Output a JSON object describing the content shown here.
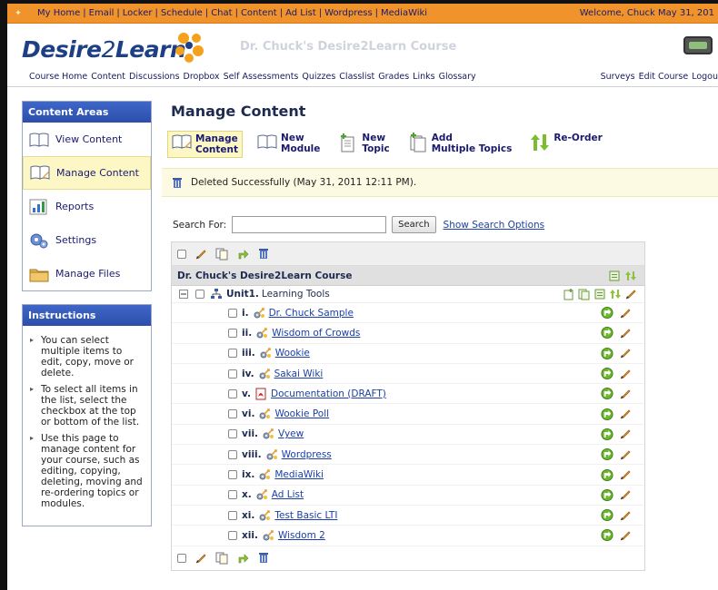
{
  "topbar": {
    "links": [
      "My Home",
      "Email",
      "Locker",
      "Schedule",
      "Chat",
      "Content",
      "Ad List",
      "Wordpress",
      "MediaWiki"
    ],
    "separator": "|",
    "welcome": "Welcome, Chuck  May 31, 201"
  },
  "header": {
    "logo_main": "Desire",
    "logo_two": "2",
    "logo_learn": "Learn",
    "course_title": "Dr. Chuck's Desire2Learn Course",
    "course_nav": [
      "Course Home",
      "Content",
      "Discussions",
      "Dropbox",
      "Self Assessments",
      "Quizzes",
      "Classlist",
      "Grades",
      "Links",
      "Glossary"
    ],
    "right_nav": [
      "Surveys",
      "Edit Course",
      "Logou"
    ]
  },
  "sidebar": {
    "content_areas_title": "Content Areas",
    "items": [
      {
        "label": "View Content",
        "icon": "book-icon"
      },
      {
        "label": "Manage Content",
        "icon": "manage-book-icon"
      },
      {
        "label": "Reports",
        "icon": "chart-icon"
      },
      {
        "label": "Settings",
        "icon": "gears-icon"
      },
      {
        "label": "Manage Files",
        "icon": "folder-icon"
      }
    ],
    "active_index": 1,
    "instructions_title": "Instructions",
    "instructions": [
      "You can select multiple items to edit, copy, move or delete.",
      "To select all items in the list, select the checkbox at the top or bottom of the list.",
      "Use this page to manage content for your course, such as editing, copying, deleting, moving and re-ordering topics or modules."
    ]
  },
  "main": {
    "title": "Manage Content",
    "toolbar": [
      {
        "line1": "Manage",
        "line2": "Content",
        "icon": "manage-content-icon"
      },
      {
        "line1": "New",
        "line2": "Module",
        "icon": "new-module-icon"
      },
      {
        "line1": "New",
        "line2": "Topic",
        "icon": "new-topic-icon"
      },
      {
        "line1": "Add",
        "line2": "Multiple Topics",
        "icon": "add-multiple-icon"
      },
      {
        "line1": "Re-Order",
        "line2": "",
        "icon": "reorder-icon"
      }
    ],
    "notice": "Deleted Successfully (May 31, 2011 12:11 PM).",
    "search_label": "Search For:",
    "search_value": "",
    "search_button": "Search",
    "search_options": "Show Search Options",
    "course_row": "Dr. Chuck's Desire2Learn Course",
    "module": {
      "label": "Unit1.",
      "title": "Learning Tools"
    },
    "topics": [
      {
        "num": "i.",
        "title": "Dr. Chuck Sample",
        "type": "tool"
      },
      {
        "num": "ii.",
        "title": "Wisdom of Crowds",
        "type": "tool"
      },
      {
        "num": "iii.",
        "title": "Wookie",
        "type": "tool"
      },
      {
        "num": "iv.",
        "title": "Sakai Wiki",
        "type": "tool"
      },
      {
        "num": "v.",
        "title": "Documentation (DRAFT)",
        "type": "pdf"
      },
      {
        "num": "vi.",
        "title": "Wookie Poll",
        "type": "tool"
      },
      {
        "num": "vii.",
        "title": "Vyew",
        "type": "tool"
      },
      {
        "num": "viii.",
        "title": "Wordpress",
        "type": "tool"
      },
      {
        "num": "ix.",
        "title": "MediaWiki",
        "type": "tool"
      },
      {
        "num": "x.",
        "title": "Ad List",
        "type": "tool"
      },
      {
        "num": "xi.",
        "title": "Test Basic LTI",
        "type": "tool"
      },
      {
        "num": "xii.",
        "title": "Wisdom 2",
        "type": "tool"
      }
    ]
  },
  "colors": {
    "topbar": "#f0932b",
    "panel_head": "#2b4eab",
    "active_bg": "#fdf7c6",
    "link": "#1a3fa8"
  }
}
